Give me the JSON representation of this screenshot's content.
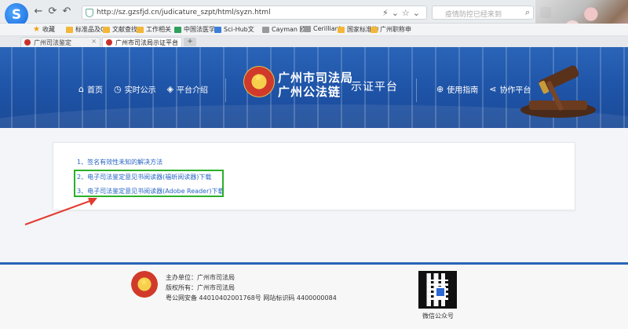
{
  "browser": {
    "url": "http://sz.gzsfjd.cn/judicature_szpt/html/syzn.html",
    "search_placeholder": "疫情防控已经来到",
    "bookmarks": [
      {
        "icon": "star-icon",
        "label": "收藏"
      },
      {
        "icon": "folder-icon",
        "label": "标准品及GC"
      },
      {
        "icon": "folder-icon",
        "label": "文献查找"
      },
      {
        "icon": "folder-icon",
        "label": "工作相关"
      },
      {
        "icon": "cnki-icon",
        "label": "中国法医学"
      },
      {
        "icon": "scihub-icon",
        "label": "Sci-Hub文"
      },
      {
        "icon": "cayman-icon",
        "label": "Cayman 欧"
      },
      {
        "icon": "cerilliant-icon",
        "label": "Cerilliant"
      },
      {
        "icon": "folder-icon",
        "label": "国家标准物"
      },
      {
        "icon": "folder-icon",
        "label": "广州职称申"
      }
    ],
    "tabs": [
      {
        "label": "广州司法鉴定",
        "active": false
      },
      {
        "label": "广州市司法局示证平台",
        "active": true
      }
    ]
  },
  "header": {
    "nav_left": [
      {
        "icon": "home-icon",
        "label": "首页"
      },
      {
        "icon": "clock-icon",
        "label": "实时公示"
      },
      {
        "icon": "layers-icon",
        "label": "平台介绍"
      }
    ],
    "brand_line1": "广州市司法局",
    "brand_line2": "广州公法链",
    "brand_sub": "示证平台",
    "nav_right": [
      {
        "icon": "compass-icon",
        "label": "使用指南"
      },
      {
        "icon": "share-icon",
        "label": "协作平台"
      }
    ]
  },
  "content": {
    "links": [
      "1、签名有效性未知的解决方法",
      "2、电子司法鉴定意见书阅读器(福昕阅读器)下载",
      "3、电子司法鉴定意见书阅读器(Adobe Reader)下载"
    ],
    "highlight_color": "#2bb02b",
    "arrow_color": "#e33b2f"
  },
  "footer": {
    "host": "主办单位：广州市司法局",
    "copyright": "版权所有：广州市司法局",
    "icp": "粤公网安备 44010402001768号 网站标识码 4400000084",
    "qr_label": "微信公众号"
  }
}
